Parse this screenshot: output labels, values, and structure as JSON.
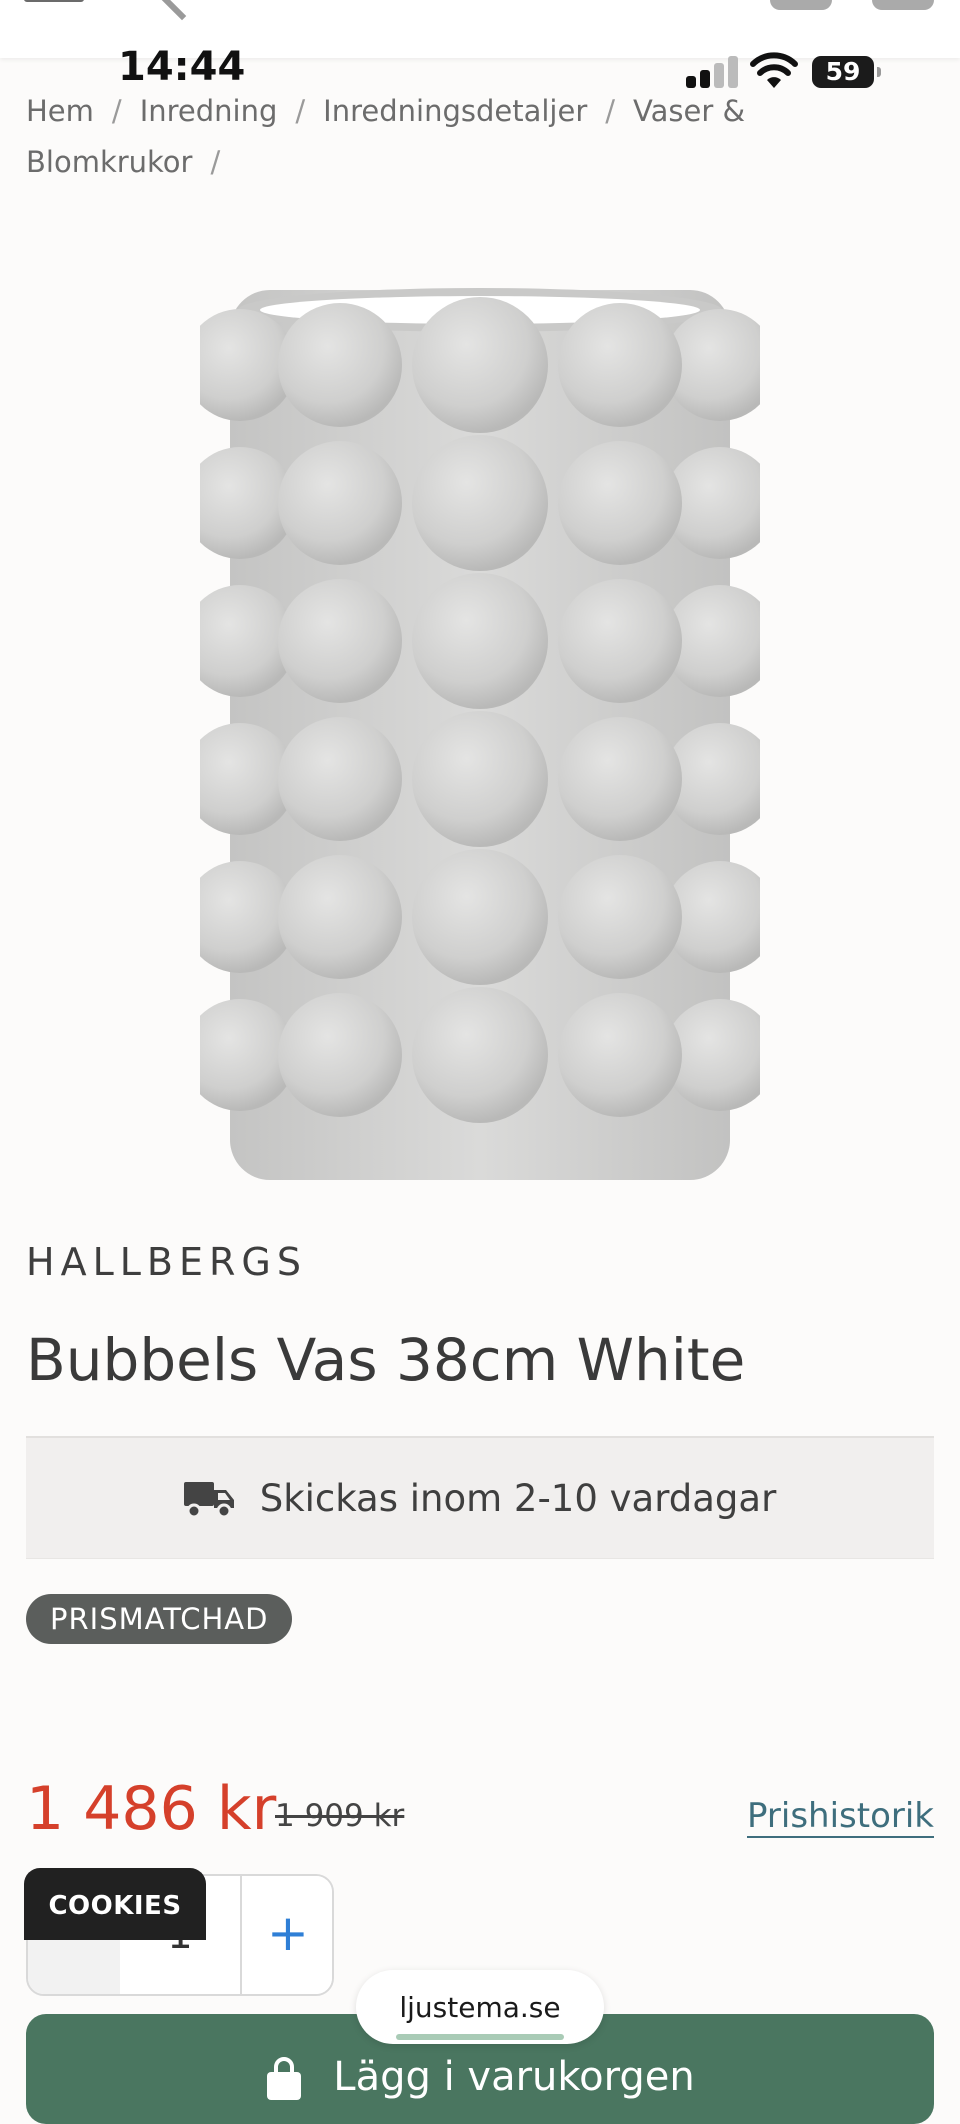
{
  "status_bar": {
    "time": "14:44",
    "battery": "59"
  },
  "breadcrumb": {
    "items": [
      "Hem",
      "Inredning",
      "Inredningsdetaljer",
      "Vaser &",
      "Blomkrukor"
    ],
    "separator": "/"
  },
  "product": {
    "brand": "HALLBERGS",
    "title": "Bubbels Vas 38cm White",
    "shipping": "Skickas inom 2-10 vardagar",
    "badge": "PRISMATCHAD",
    "price": "1 486 kr",
    "old_price": "1 909 kr",
    "price_history": "Prishistorik",
    "quantity": "1",
    "plus": "+",
    "add_to_cart": "Lägg i varukorgen"
  },
  "cookies_label": "COOKIES",
  "browser_url": "ljustema.se",
  "colors": {
    "price_red": "#d5402b",
    "cart_green": "#4a7660",
    "link_teal": "#3e6e7d",
    "badge_gray": "#5b5e5c"
  }
}
